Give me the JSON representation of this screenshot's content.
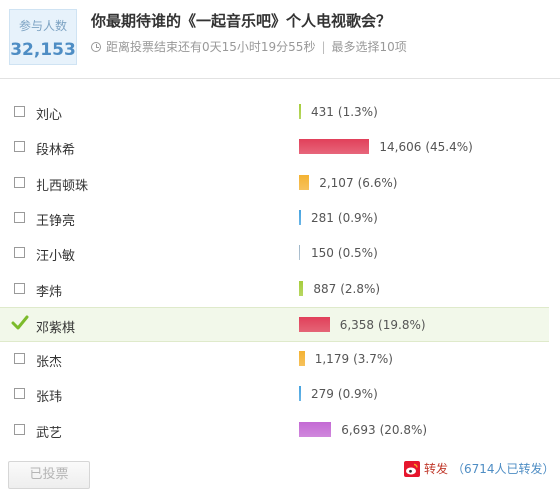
{
  "header": {
    "participants_label": "参与人数",
    "participants_count": "32,153",
    "title": "你最期待谁的《一起音乐吧》个人电视歌会？",
    "countdown_text": "距离投票结束还有0天15小时19分55秒",
    "separator": "|",
    "max_choice_text": "最多选择10项"
  },
  "options": [
    {
      "name": "刘心",
      "votes": "431",
      "pct_text": "(1.3%)",
      "percent": 1.3,
      "color": "#a6cd3c",
      "checked": false
    },
    {
      "name": "段林希",
      "votes": "14,606",
      "pct_text": "(45.4%)",
      "percent": 45.4,
      "color": "#e1405a",
      "checked": false
    },
    {
      "name": "扎西顿珠",
      "votes": "2,107",
      "pct_text": "(6.6%)",
      "percent": 6.6,
      "color": "#f4b233",
      "checked": false
    },
    {
      "name": "王铮亮",
      "votes": "281",
      "pct_text": "(0.9%)",
      "percent": 0.9,
      "color": "#46a3e0",
      "checked": false
    },
    {
      "name": "汪小敏",
      "votes": "150",
      "pct_text": "(0.5%)",
      "percent": 0.5,
      "color": "#9fb6c8",
      "checked": false
    },
    {
      "name": "李炜",
      "votes": "887",
      "pct_text": "(2.8%)",
      "percent": 2.8,
      "color": "#a6cd3c",
      "checked": false
    },
    {
      "name": "邓紫棋",
      "votes": "6,358",
      "pct_text": "(19.8%)",
      "percent": 19.8,
      "color": "#e1405a",
      "checked": true
    },
    {
      "name": "张杰",
      "votes": "1,179",
      "pct_text": "(3.7%)",
      "percent": 3.7,
      "color": "#f4b233",
      "checked": false
    },
    {
      "name": "张玮",
      "votes": "279",
      "pct_text": "(0.9%)",
      "percent": 0.9,
      "color": "#46a3e0",
      "checked": false
    },
    {
      "name": "武艺",
      "votes": "6,693",
      "pct_text": "(20.8%)",
      "percent": 20.8,
      "color": "#c46ad4",
      "checked": false
    }
  ],
  "footer": {
    "voted_button": "已投票",
    "share_label": "转发",
    "share_count": "（6714人已转发）"
  },
  "colors": {
    "accent_blue": "#4e8dc4",
    "check_green": "#7cbb2b",
    "share_red": "#c0392b"
  }
}
